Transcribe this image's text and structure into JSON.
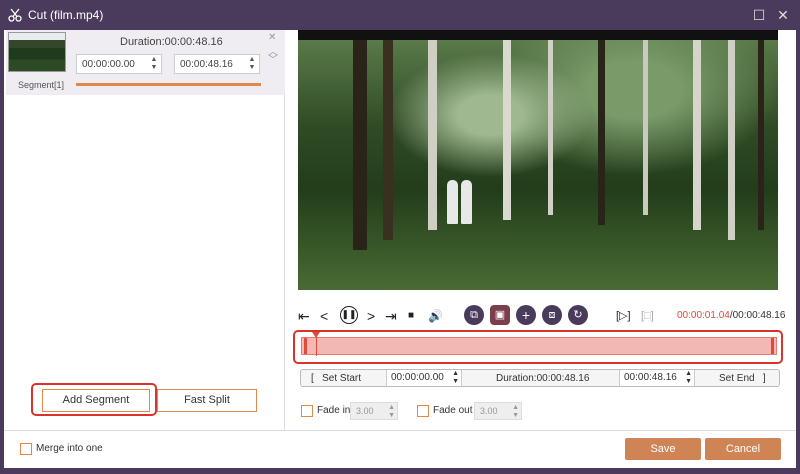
{
  "window": {
    "title": "Cut (film.mp4)",
    "icon": "scissors-icon"
  },
  "segment": {
    "duration": "Duration:00:00:48.16",
    "start": "00:00:00.00",
    "end": "00:00:48.16",
    "name": "Segment[1]"
  },
  "left_buttons": {
    "add_segment": "Add Segment",
    "fast_split": "Fast Split"
  },
  "player": {
    "current_time": "00:00:01.04",
    "total_time": "/00:00:48.16"
  },
  "set_row": {
    "set_start": "Set Start",
    "start_time": "00:00:00.00",
    "duration": "Duration:00:00:48.16",
    "end_time": "00:00:48.16",
    "set_end": "Set End"
  },
  "fade": {
    "fade_in": "Fade in",
    "fade_in_value": "3.00",
    "fade_out": "Fade out",
    "fade_out_value": "3.00"
  },
  "bottom": {
    "merge": "Merge into one",
    "save": "Save",
    "cancel": "Cancel"
  },
  "colors": {
    "accent": "#e0874a",
    "highlight": "#d9342b",
    "titlebar": "#4a3b5c"
  }
}
